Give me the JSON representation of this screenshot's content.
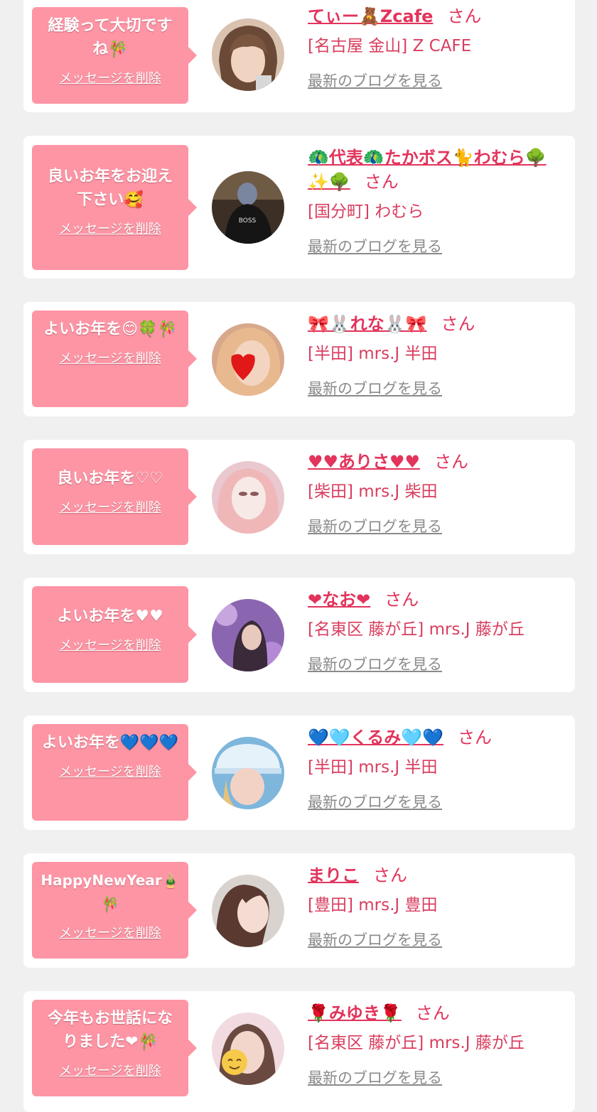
{
  "delete_label": "メッセージを削除",
  "san_label": "さん",
  "blog_label": "最新のブログを見る",
  "colors": {
    "bubble": "#fd95a5",
    "name": "#e2345c",
    "link_gray": "#8a8a8a",
    "page_bg": "#f0f0f0"
  },
  "cards": [
    {
      "message": "経験って大切ですね🎋",
      "name": "てぃー🧸Zcafe",
      "shop": "[名古屋 金山] Z CAFE"
    },
    {
      "message": "良いお年をお迎え下さい🥰",
      "name": "🦚代表🦚たかボス🐈わむら🌳✨🌳",
      "shop": "[国分町] わむら"
    },
    {
      "message": "よいお年を😊🍀🎋",
      "name": "🎀🐰れな🐰🎀",
      "shop": "[半田] mrs.J 半田"
    },
    {
      "message": "良いお年を♡♡",
      "name": "♥♥ありさ♥♥",
      "shop": "[柴田] mrs.J 柴田"
    },
    {
      "message": "よいお年を♥♥",
      "name": "❤なお❤",
      "shop": "[名東区 藤が丘] mrs.J 藤が丘"
    },
    {
      "message": "よいお年を💙💙💙",
      "name": "💙🩵くるみ🩵💙",
      "shop": "[半田] mrs.J 半田"
    },
    {
      "message": "HappyNewYear🎍🎋",
      "name": "まりこ",
      "shop": "[豊田] mrs.J 豊田"
    },
    {
      "message": "今年もお世話になりました❤🎋",
      "name": "🌹みゆき🌹",
      "shop": "[名東区 藤が丘] mrs.J 藤が丘"
    }
  ]
}
